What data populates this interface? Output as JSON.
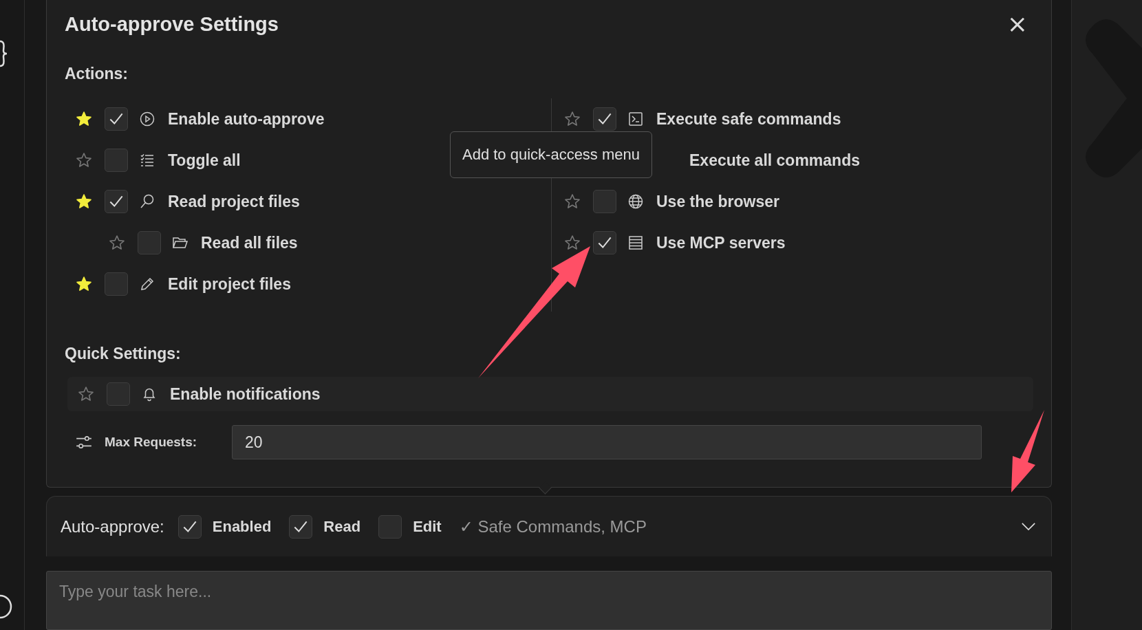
{
  "dialog": {
    "title": "Auto-approve Settings",
    "close": "×"
  },
  "actions": {
    "heading": "Actions:",
    "left": [
      {
        "label": "Enable auto-approve",
        "starred": true,
        "checked": true
      },
      {
        "label": "Toggle all",
        "starred": false,
        "checked": false
      },
      {
        "label": "Read project files",
        "starred": true,
        "checked": true,
        "children": [
          {
            "label": "Read all files",
            "starred": false,
            "checked": false
          }
        ]
      },
      {
        "label": "Edit project files",
        "starred": true,
        "checked": false
      }
    ],
    "right": [
      {
        "label": "Execute safe commands",
        "starred": false,
        "checked": true,
        "children": [
          {
            "label": "Execute all commands",
            "kind": "covered"
          }
        ]
      },
      {
        "label": "Use the browser",
        "starred": false,
        "checked": false
      },
      {
        "label": "Use MCP servers",
        "starred": false,
        "checked": true
      }
    ]
  },
  "tooltip": "Add to quick-access menu",
  "quick_settings": {
    "heading": "Quick Settings:",
    "notifications": {
      "label": "Enable notifications",
      "starred": false,
      "checked": false
    },
    "max_requests": {
      "label": "Max Requests:",
      "value": "20"
    }
  },
  "auto_approve_bar": {
    "label": "Auto-approve:",
    "toggles": [
      {
        "label": "Enabled",
        "checked": true
      },
      {
        "label": "Read",
        "checked": true
      },
      {
        "label": "Edit",
        "checked": false
      }
    ],
    "summary": "✓ Safe Commands, MCP"
  },
  "task_input": {
    "placeholder": "Type your task here..."
  },
  "annotations": [
    {
      "kind": "arrow"
    },
    {
      "kind": "arrow"
    }
  ]
}
